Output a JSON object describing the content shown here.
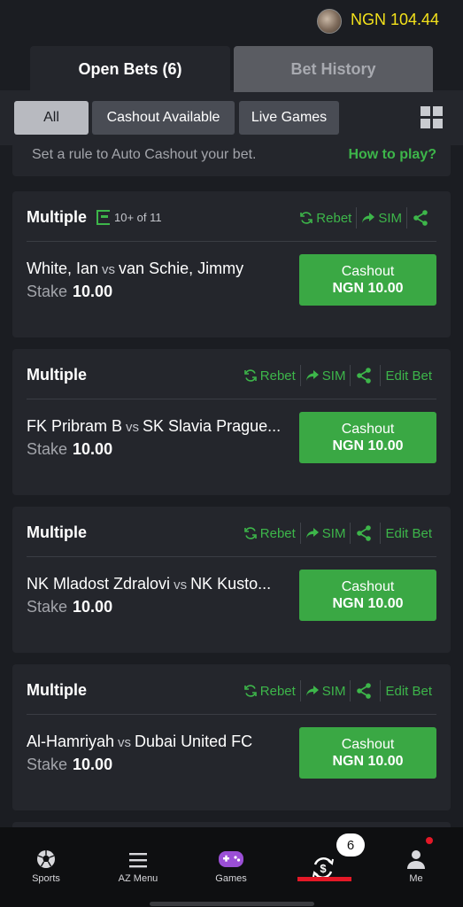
{
  "header": {
    "balance": "NGN 104.44"
  },
  "tabs": [
    {
      "label": "Open Bets (6)",
      "active": true
    },
    {
      "label": "Bet History",
      "active": false
    }
  ],
  "filters": [
    {
      "label": "All",
      "active": true
    },
    {
      "label": "Cashout Available",
      "active": false
    },
    {
      "label": "Live Games",
      "active": false
    }
  ],
  "auto_cashout": {
    "text": "Set a rule to Auto Cashout your bet.",
    "link": "How to play?"
  },
  "actions": {
    "rebet": "Rebet",
    "sim": "SIM",
    "edit_bet": "Edit Bet"
  },
  "bets": [
    {
      "type": "Multiple",
      "odds_count": "10+ of 11",
      "home": "White, Ian",
      "vs": "vs",
      "away": "van Schie, Jimmy",
      "stake_label": "Stake",
      "stake": "10.00",
      "cashout_label": "Cashout",
      "cashout_amount": "NGN 10.00"
    },
    {
      "type": "Multiple",
      "home": "FK Pribram B",
      "vs": "vs",
      "away": "SK Slavia Prague...",
      "stake_label": "Stake",
      "stake": "10.00",
      "cashout_label": "Cashout",
      "cashout_amount": "NGN 10.00"
    },
    {
      "type": "Multiple",
      "home": "NK Mladost Zdralovi",
      "vs": "vs",
      "away": "NK Kusto...",
      "stake_label": "Stake",
      "stake": "10.00",
      "cashout_label": "Cashout",
      "cashout_amount": "NGN 10.00"
    },
    {
      "type": "Multiple",
      "home": "Al-Hamriyah",
      "vs": "vs",
      "away": "Dubai United FC",
      "stake_label": "Stake",
      "stake": "10.00",
      "cashout_label": "Cashout",
      "cashout_amount": "NGN 10.00"
    }
  ],
  "bottom_nav": {
    "sports": "Sports",
    "az_menu": "AZ Menu",
    "games": "Games",
    "betslip_count": "6",
    "me": "Me"
  },
  "colors": {
    "accent_green": "#3db64a",
    "balance_yellow": "#f3e11b",
    "alert_red": "#e41827"
  }
}
